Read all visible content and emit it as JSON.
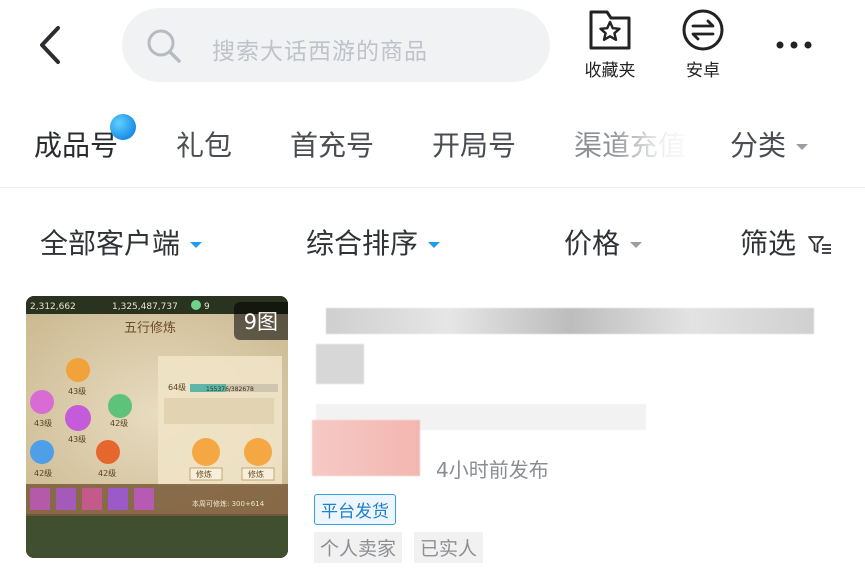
{
  "header": {
    "search_placeholder": "搜索大话西游的商品",
    "favorites_label": "收藏夹",
    "android_label": "安卓"
  },
  "tabs": [
    {
      "label": "成品号",
      "active": true
    },
    {
      "label": "礼包"
    },
    {
      "label": "首充号"
    },
    {
      "label": "开局号"
    },
    {
      "label": "渠道充值"
    },
    {
      "label": "分类"
    }
  ],
  "filters": {
    "client": "全部客户端",
    "sort": "综合排序",
    "price": "价格",
    "screen": "筛选"
  },
  "listing": {
    "image_count": "9图",
    "posted": "4小时前发布",
    "tag_platform": "平台发货",
    "tag_seller": "个人卖家",
    "tag_verified": "已实人",
    "thumbnail": {
      "top_stats": [
        "2,312,662",
        "1,325,487,737",
        "9"
      ],
      "panel_title": "五行修炼",
      "level": "64级",
      "progress_text": "155376/382678",
      "progress_fraction": 0.41,
      "orb_levels": [
        "43级",
        "43级",
        "42级",
        "43级",
        "42级",
        "42级"
      ],
      "button_label": "修炼",
      "bottom_text": "本周可修炼: 300+614"
    }
  },
  "colors": {
    "accent_blue": "#1f9bf0",
    "platform_tag": "#1f80c8",
    "muted_text": "#8a8d92"
  }
}
